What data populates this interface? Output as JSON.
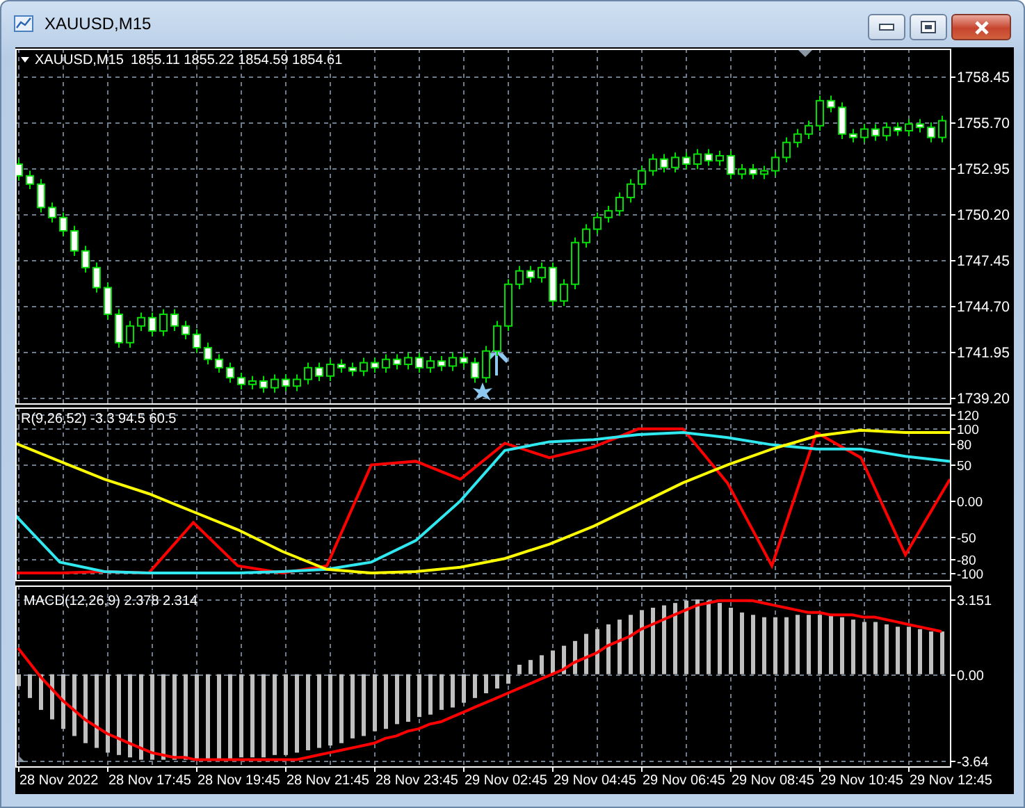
{
  "window": {
    "title": "XAUUSD,M15"
  },
  "chart": {
    "symbol": "XAUUSD,M15",
    "quote": "1855.11 1855.22 1854.59 1854.61",
    "chart_data": {
      "type": "candlestick",
      "grid": true,
      "ylim": [
        1739.2,
        1758.45
      ],
      "yticks": [
        {
          "value": 1758.45,
          "label": "1758.45"
        },
        {
          "value": 1755.7,
          "label": "1755.70"
        },
        {
          "value": 1752.95,
          "label": "1752.95"
        },
        {
          "value": 1750.2,
          "label": "1750.20"
        },
        {
          "value": 1747.45,
          "label": "1747.45"
        },
        {
          "value": 1744.7,
          "label": "1744.70"
        },
        {
          "value": 1741.95,
          "label": "1741.95"
        },
        {
          "value": 1739.2,
          "label": "1739.20"
        }
      ],
      "ohlc": [
        [
          1753.2,
          1753.5,
          1752.2,
          1752.5
        ],
        [
          1752.5,
          1752.8,
          1751.7,
          1752.0
        ],
        [
          1752.0,
          1752.3,
          1750.3,
          1750.6
        ],
        [
          1750.6,
          1750.9,
          1749.7,
          1750.0
        ],
        [
          1750.0,
          1750.3,
          1748.9,
          1749.2
        ],
        [
          1749.2,
          1749.5,
          1747.7,
          1748.0
        ],
        [
          1748.0,
          1748.3,
          1746.7,
          1747.0
        ],
        [
          1747.0,
          1747.3,
          1745.5,
          1745.8
        ],
        [
          1745.8,
          1746.1,
          1743.9,
          1744.2
        ],
        [
          1744.2,
          1744.5,
          1742.2,
          1742.5
        ],
        [
          1742.5,
          1743.8,
          1742.2,
          1743.5
        ],
        [
          1743.5,
          1744.3,
          1743.2,
          1744.0
        ],
        [
          1744.0,
          1744.3,
          1742.9,
          1743.2
        ],
        [
          1743.2,
          1744.5,
          1742.9,
          1744.2
        ],
        [
          1744.2,
          1744.5,
          1743.2,
          1743.5
        ],
        [
          1743.5,
          1743.8,
          1742.7,
          1743.0
        ],
        [
          1743.0,
          1743.3,
          1741.9,
          1742.2
        ],
        [
          1742.2,
          1742.5,
          1741.2,
          1741.5
        ],
        [
          1741.5,
          1741.8,
          1740.7,
          1741.0
        ],
        [
          1741.0,
          1741.3,
          1740.1,
          1740.4
        ],
        [
          1740.4,
          1740.7,
          1739.7,
          1740.0
        ],
        [
          1740.0,
          1740.5,
          1739.7,
          1740.2
        ],
        [
          1740.2,
          1740.5,
          1739.5,
          1739.8
        ],
        [
          1739.8,
          1740.6,
          1739.5,
          1740.3
        ],
        [
          1740.3,
          1740.6,
          1739.6,
          1739.9
        ],
        [
          1739.9,
          1740.6,
          1739.6,
          1740.3
        ],
        [
          1740.3,
          1741.3,
          1740.0,
          1741.0
        ],
        [
          1741.0,
          1741.3,
          1740.2,
          1740.5
        ],
        [
          1740.5,
          1741.5,
          1740.2,
          1741.2
        ],
        [
          1741.2,
          1741.5,
          1740.7,
          1741.0
        ],
        [
          1741.0,
          1741.3,
          1740.5,
          1740.8
        ],
        [
          1740.8,
          1741.6,
          1740.5,
          1741.3
        ],
        [
          1741.3,
          1741.6,
          1740.7,
          1741.0
        ],
        [
          1741.0,
          1741.8,
          1740.7,
          1741.5
        ],
        [
          1741.5,
          1741.8,
          1740.9,
          1741.2
        ],
        [
          1741.2,
          1741.9,
          1740.9,
          1741.6
        ],
        [
          1741.6,
          1741.9,
          1740.7,
          1741.0
        ],
        [
          1741.0,
          1741.7,
          1740.7,
          1741.4
        ],
        [
          1741.4,
          1741.7,
          1740.8,
          1741.1
        ],
        [
          1741.1,
          1741.9,
          1740.8,
          1741.6
        ],
        [
          1741.6,
          1741.9,
          1741.0,
          1741.3
        ],
        [
          1741.3,
          1741.6,
          1740.1,
          1740.4
        ],
        [
          1740.4,
          1742.3,
          1740.1,
          1742.0
        ],
        [
          1742.0,
          1743.8,
          1741.7,
          1743.5
        ],
        [
          1743.5,
          1746.3,
          1743.2,
          1746.0
        ],
        [
          1746.0,
          1747.1,
          1745.7,
          1746.8
        ],
        [
          1746.8,
          1747.1,
          1746.1,
          1746.4
        ],
        [
          1746.4,
          1747.3,
          1746.1,
          1747.0
        ],
        [
          1747.0,
          1747.3,
          1744.7,
          1745.0
        ],
        [
          1745.0,
          1746.3,
          1744.7,
          1746.0
        ],
        [
          1746.0,
          1748.8,
          1745.7,
          1748.5
        ],
        [
          1748.5,
          1749.6,
          1748.2,
          1749.3
        ],
        [
          1749.3,
          1750.3,
          1749.0,
          1750.0
        ],
        [
          1750.0,
          1750.7,
          1749.7,
          1750.4
        ],
        [
          1750.4,
          1751.5,
          1750.1,
          1751.2
        ],
        [
          1751.2,
          1752.3,
          1750.9,
          1752.0
        ],
        [
          1752.0,
          1753.1,
          1751.7,
          1752.8
        ],
        [
          1752.8,
          1753.8,
          1752.5,
          1753.5
        ],
        [
          1753.5,
          1753.8,
          1752.7,
          1753.0
        ],
        [
          1753.0,
          1753.9,
          1752.7,
          1753.6
        ],
        [
          1753.6,
          1753.9,
          1752.9,
          1753.2
        ],
        [
          1753.2,
          1754.1,
          1752.9,
          1753.8
        ],
        [
          1753.8,
          1754.1,
          1753.1,
          1753.4
        ],
        [
          1753.4,
          1754.0,
          1753.1,
          1753.7
        ],
        [
          1753.7,
          1754.0,
          1752.3,
          1752.6
        ],
        [
          1752.6,
          1753.2,
          1752.3,
          1752.9
        ],
        [
          1752.9,
          1753.2,
          1752.3,
          1752.6
        ],
        [
          1752.6,
          1753.1,
          1752.3,
          1752.8
        ],
        [
          1752.8,
          1753.9,
          1752.5,
          1753.6
        ],
        [
          1753.6,
          1754.8,
          1753.3,
          1754.5
        ],
        [
          1754.5,
          1755.3,
          1754.2,
          1755.0
        ],
        [
          1755.0,
          1755.8,
          1754.7,
          1755.5
        ],
        [
          1755.5,
          1757.3,
          1755.2,
          1757.0
        ],
        [
          1757.0,
          1757.3,
          1756.3,
          1756.6
        ],
        [
          1756.6,
          1756.9,
          1754.7,
          1755.0
        ],
        [
          1755.0,
          1755.3,
          1754.5,
          1754.8
        ],
        [
          1754.8,
          1755.6,
          1754.5,
          1755.3
        ],
        [
          1755.3,
          1755.6,
          1754.6,
          1754.9
        ],
        [
          1754.9,
          1755.7,
          1754.6,
          1755.4
        ],
        [
          1755.4,
          1755.7,
          1754.9,
          1755.2
        ],
        [
          1755.2,
          1755.9,
          1754.9,
          1755.6
        ],
        [
          1755.6,
          1755.9,
          1755.1,
          1755.4
        ],
        [
          1755.4,
          1755.7,
          1754.5,
          1754.8
        ],
        [
          1754.8,
          1756.1,
          1754.5,
          1755.8
        ]
      ]
    }
  },
  "indicator_pane": {
    "label": "R(9,26,52) -3.3 94.5 60.5",
    "chart_data": {
      "type": "line",
      "grid": true,
      "ylim": [
        -100,
        120
      ],
      "yticks": [
        120,
        100,
        80,
        50,
        {
          "value": 0,
          "label": "0.00"
        },
        -50,
        -80,
        -100
      ],
      "series": [
        {
          "color": "#ff0000",
          "values": [
            -100,
            -100,
            -98,
            -100,
            -30,
            -90,
            -100,
            -90,
            50,
            55,
            30,
            80,
            60,
            75,
            100,
            100,
            25,
            -90,
            95,
            60,
            -75,
            30
          ]
        },
        {
          "color": "#30e8f0",
          "values": [
            -20,
            -85,
            -98,
            -100,
            -100,
            -100,
            -98,
            -95,
            -85,
            -55,
            0,
            70,
            82,
            85,
            92,
            95,
            88,
            78,
            72,
            72,
            62,
            55
          ]
        },
        {
          "color": "#ffff00",
          "values": [
            80,
            55,
            30,
            10,
            -15,
            -40,
            -70,
            -95,
            -100,
            -98,
            -92,
            -80,
            -60,
            -35,
            -5,
            25,
            50,
            72,
            90,
            98,
            95,
            95
          ]
        }
      ]
    }
  },
  "macd_pane": {
    "label": "MACD(12,26,9) 2.378 2.314",
    "chart_data": {
      "type": "bar",
      "grid": true,
      "ylim": [
        -3.64,
        3.151
      ],
      "yticks": [
        3.151,
        {
          "value": 0,
          "label": "0.00"
        },
        -3.64
      ],
      "series": [
        {
          "type": "bar",
          "color": "#c0c0c0",
          "values": [
            -0.5,
            -1.0,
            -1.5,
            -1.9,
            -2.3,
            -2.6,
            -2.9,
            -3.1,
            -3.3,
            -3.4,
            -3.5,
            -3.6,
            -3.6,
            -3.6,
            -3.6,
            -3.6,
            -3.6,
            -3.6,
            -3.6,
            -3.6,
            -3.5,
            -3.5,
            -3.5,
            -3.4,
            -3.4,
            -3.3,
            -3.2,
            -3.1,
            -3.0,
            -2.9,
            -2.7,
            -2.6,
            -2.4,
            -2.3,
            -2.1,
            -2.0,
            -1.8,
            -1.7,
            -1.5,
            -1.4,
            -1.2,
            -1.0,
            -0.8,
            -0.6,
            -0.4,
            0.4,
            0.6,
            0.8,
            1.0,
            1.2,
            1.4,
            1.7,
            1.9,
            2.1,
            2.3,
            2.5,
            2.7,
            2.8,
            2.9,
            3.0,
            3.1,
            3.15,
            3.1,
            3.0,
            2.8,
            2.6,
            2.5,
            2.4,
            2.4,
            2.4,
            2.5,
            2.5,
            2.5,
            2.5,
            2.4,
            2.3,
            2.2,
            2.2,
            2.1,
            2.0,
            2.0,
            1.9,
            1.8,
            1.8
          ]
        },
        {
          "type": "line",
          "color": "#ff0000",
          "values": [
            1.1,
            0.5,
            -0.1,
            -0.6,
            -1.1,
            -1.5,
            -1.9,
            -2.2,
            -2.5,
            -2.7,
            -2.9,
            -3.1,
            -3.3,
            -3.4,
            -3.5,
            -3.5,
            -3.6,
            -3.6,
            -3.6,
            -3.6,
            -3.6,
            -3.6,
            -3.6,
            -3.6,
            -3.6,
            -3.6,
            -3.5,
            -3.4,
            -3.3,
            -3.2,
            -3.1,
            -3.0,
            -2.9,
            -2.7,
            -2.6,
            -2.4,
            -2.3,
            -2.1,
            -2.0,
            -1.8,
            -1.6,
            -1.4,
            -1.2,
            -1.0,
            -0.8,
            -0.6,
            -0.4,
            -0.2,
            0.0,
            0.2,
            0.5,
            0.7,
            0.9,
            1.2,
            1.4,
            1.6,
            1.9,
            2.1,
            2.3,
            2.5,
            2.7,
            2.9,
            3.0,
            3.1,
            3.1,
            3.1,
            3.1,
            3.0,
            2.9,
            2.8,
            2.7,
            2.6,
            2.6,
            2.5,
            2.5,
            2.5,
            2.4,
            2.4,
            2.3,
            2.2,
            2.1,
            2.0,
            1.9,
            1.8
          ]
        }
      ]
    }
  },
  "time_axis": [
    "28 Nov 2022",
    "28 Nov 17:45",
    "28 Nov 19:45",
    "28 Nov 21:45",
    "28 Nov 23:45",
    "29 Nov 02:45",
    "29 Nov 04:45",
    "29 Nov 06:45",
    "29 Nov 08:45",
    "29 Nov 10:45",
    "29 Nov 12:45"
  ]
}
